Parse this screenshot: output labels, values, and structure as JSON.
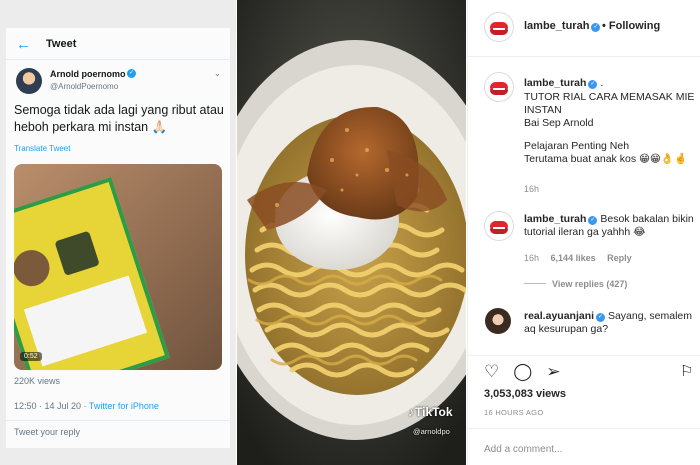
{
  "twitter": {
    "back_icon": "arrow-left-icon",
    "header_title": "Tweet",
    "author_name": "Arnold poernomo",
    "author_handle": "@ArnoldPoernomo",
    "tweet_text": "Semoga tidak ada lagi yang ribut atau heboh perkara mi instan 🙏🏻",
    "translate_label": "Translate Tweet",
    "video_duration": "0:52",
    "views": "220K views",
    "time_date": "12:50 · 14 Jul 20 · ",
    "source": "Twitter for iPhone",
    "reply_placeholder": "Tweet your reply",
    "accent_color": "#1da1f2"
  },
  "photo": {
    "watermark": "TikTok",
    "watermark_handle": "@arnoldpo"
  },
  "instagram": {
    "header_username": "lambe_turah",
    "follow_label": "• Following",
    "caption": {
      "username": "lambe_turah",
      "suffix": " .",
      "line1": "TUTOR RIAL CARA MEMASAK MIE INSTAN",
      "line2": "Bai Sep Arnold",
      "line3": "Pelajaran Penting Neh",
      "line4": "Terutama buat anak kos 😁😁👌🤞",
      "time": "16h"
    },
    "comment1": {
      "username": "lambe_turah",
      "text": " Besok bakalan bikin tutorial ileran ga yahhh 😂",
      "time": "16h",
      "likes": "6,144 likes",
      "reply": "Reply",
      "view_replies": "View replies (427)"
    },
    "comment2": {
      "username": "real.ayuanjani",
      "text": " Sayang, semalem aq kesurupan ga?"
    },
    "action_icons": [
      "heart-icon",
      "comment-icon",
      "share-icon",
      "bookmark-icon"
    ],
    "views": "3,053,083 views",
    "time_ago": "16 HOURS AGO",
    "add_comment_placeholder": "Add a comment..."
  }
}
